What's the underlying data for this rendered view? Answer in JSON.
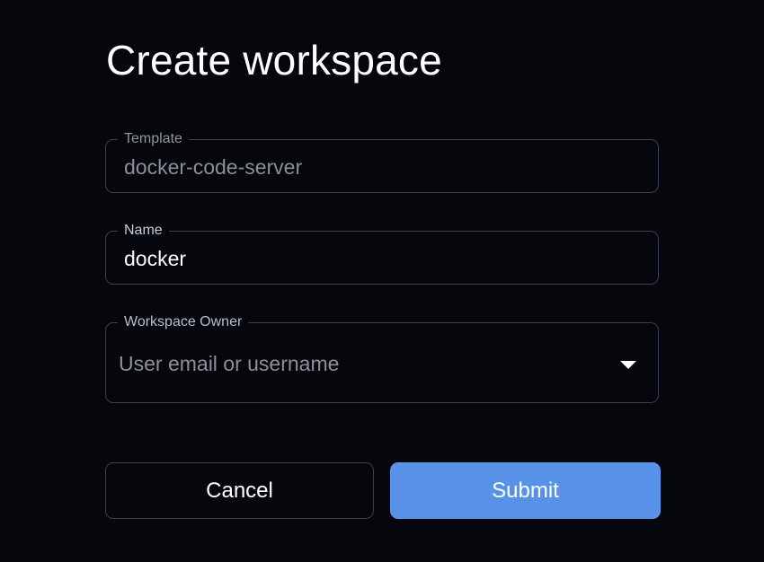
{
  "page": {
    "title": "Create workspace"
  },
  "form": {
    "template": {
      "label": "Template",
      "value": "docker-code-server"
    },
    "name": {
      "label": "Name",
      "value": "docker"
    },
    "owner": {
      "label": "Workspace Owner",
      "placeholder": "User email or username",
      "icon": "chevron-down-icon"
    }
  },
  "actions": {
    "cancel_label": "Cancel",
    "submit_label": "Submit"
  },
  "colors": {
    "background": "#05070c",
    "accent": "#5892e8",
    "border": "#3a3f52"
  }
}
